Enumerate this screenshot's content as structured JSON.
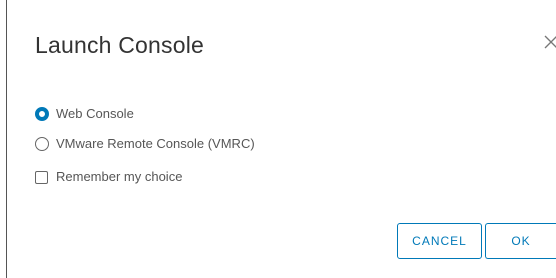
{
  "dialog": {
    "title": "Launch Console",
    "close_icon": "close-icon"
  },
  "options": {
    "web_console": {
      "label": "Web Console",
      "selected": true
    },
    "vmrc": {
      "label": "VMware Remote Console (VMRC)",
      "selected": false
    }
  },
  "remember": {
    "label": "Remember my choice",
    "checked": false
  },
  "buttons": {
    "cancel": "CANCEL",
    "ok": "OK"
  },
  "colors": {
    "accent": "#0079b8",
    "text": "#565656",
    "title": "#333333"
  }
}
